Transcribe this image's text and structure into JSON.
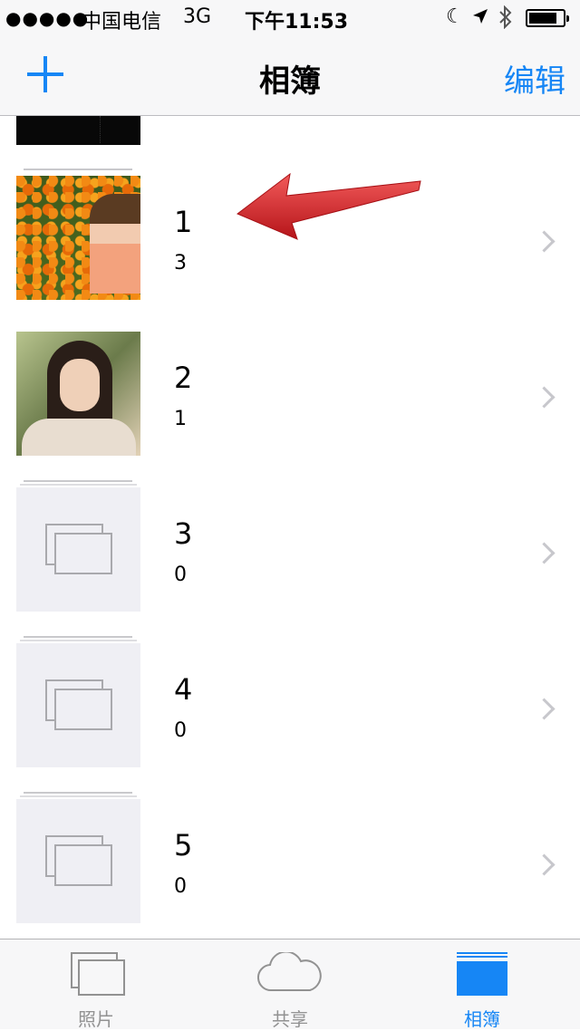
{
  "status_bar": {
    "signal": "●●●●●",
    "carrier": "中国电信",
    "network": "3G",
    "time": "下午11:53"
  },
  "nav": {
    "title": "相簿",
    "edit_label": "编辑"
  },
  "albums": [
    {
      "name": "1",
      "count": "3"
    },
    {
      "name": "2",
      "count": "1"
    },
    {
      "name": "3",
      "count": "0"
    },
    {
      "name": "4",
      "count": "0"
    },
    {
      "name": "5",
      "count": "0"
    }
  ],
  "tabs": [
    {
      "label": "照片"
    },
    {
      "label": "共享"
    },
    {
      "label": "相簿"
    }
  ],
  "colors": {
    "accent": "#1686f5",
    "arrow": "#d9262c"
  }
}
